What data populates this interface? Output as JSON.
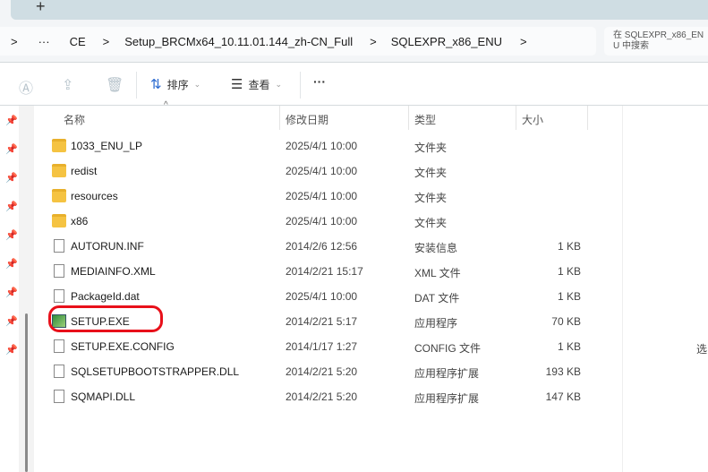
{
  "tabbar": {
    "new_tab": "+"
  },
  "breadcrumb": {
    "items": [
      ">",
      "···",
      "CE",
      ">",
      "Setup_BRCMx64_10.11.01.144_zh-CN_Full",
      ">",
      "SQLEXPR_x86_ENU",
      ">"
    ]
  },
  "search": {
    "placeholder": "在 SQLEXPR_x86_ENU 中搜索"
  },
  "toolbar": {
    "sort": "排序",
    "view": "查看",
    "more": "···"
  },
  "columns": {
    "name": "名称",
    "date": "修改日期",
    "type": "类型",
    "size": "大小"
  },
  "files": [
    {
      "name": "1033_ENU_LP",
      "date": "2025/4/1 10:00",
      "type": "文件夹",
      "size": "",
      "icon": "folder"
    },
    {
      "name": "redist",
      "date": "2025/4/1 10:00",
      "type": "文件夹",
      "size": "",
      "icon": "folder"
    },
    {
      "name": "resources",
      "date": "2025/4/1 10:00",
      "type": "文件夹",
      "size": "",
      "icon": "folder"
    },
    {
      "name": "x86",
      "date": "2025/4/1 10:00",
      "type": "文件夹",
      "size": "",
      "icon": "folder"
    },
    {
      "name": "AUTORUN.INF",
      "date": "2014/2/6 12:56",
      "type": "安装信息",
      "size": "1 KB",
      "icon": "file"
    },
    {
      "name": "MEDIAINFO.XML",
      "date": "2014/2/21 15:17",
      "type": "XML 文件",
      "size": "1 KB",
      "icon": "file"
    },
    {
      "name": "PackageId.dat",
      "date": "2025/4/1 10:00",
      "type": "DAT 文件",
      "size": "1 KB",
      "icon": "file"
    },
    {
      "name": "SETUP.EXE",
      "date": "2014/2/21 5:17",
      "type": "应用程序",
      "size": "70 KB",
      "icon": "exe"
    },
    {
      "name": "SETUP.EXE.CONFIG",
      "date": "2014/1/17 1:27",
      "type": "CONFIG 文件",
      "size": "1 KB",
      "icon": "file"
    },
    {
      "name": "SQLSETUPBOOTSTRAPPER.DLL",
      "date": "2014/2/21 5:20",
      "type": "应用程序扩展",
      "size": "193 KB",
      "icon": "file"
    },
    {
      "name": "SQMAPI.DLL",
      "date": "2014/2/21 5:20",
      "type": "应用程序扩展",
      "size": "147 KB",
      "icon": "file"
    }
  ],
  "details_pane": {
    "text": "选"
  },
  "highlight_color": "#e8101a"
}
